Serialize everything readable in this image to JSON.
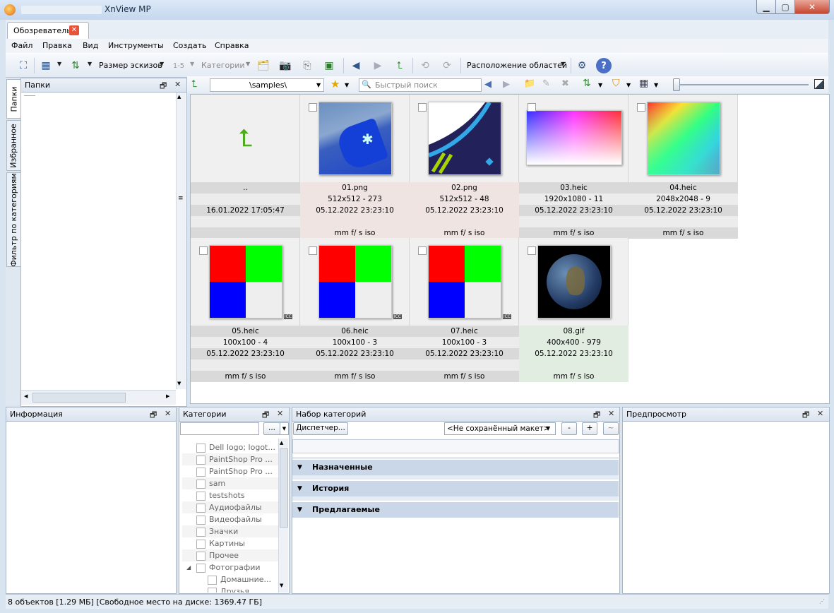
{
  "window": {
    "title": "XnView MP"
  },
  "tab": {
    "label": "Обозреватель"
  },
  "menu": [
    "Файл",
    "Правка",
    "Вид",
    "Инструменты",
    "Создать",
    "Справка"
  ],
  "toolbar": {
    "thumb_size_label": "Размер эскизов",
    "categories_label": "Категории",
    "layout_label": "Расположение областей"
  },
  "left_tabs": [
    "Папки",
    "Избранное",
    "Фильтр по категориям"
  ],
  "folders": {
    "title": "Папки"
  },
  "address": {
    "path": "\\samples\\",
    "search_placeholder": "Быстрый поиск"
  },
  "thumbnails": [
    {
      "name": "..",
      "info": "",
      "date": "16.01.2022 17:05:47",
      "exif": "",
      "kind": "up"
    },
    {
      "name": "01.png",
      "info": "512x512 - 273",
      "date": "05.12.2022 23:23:10",
      "exif": "mm f/ s iso",
      "kind": "hat",
      "bg": "#efe4e1"
    },
    {
      "name": "02.png",
      "info": "512x512 - 48",
      "date": "05.12.2022 23:23:10",
      "exif": "mm f/ s iso",
      "kind": "logo",
      "bg": "#efe4e1"
    },
    {
      "name": "03.heic",
      "info": "1920x1080 - 11",
      "date": "05.12.2022 23:23:10",
      "exif": "mm f/ s iso",
      "kind": "grad1"
    },
    {
      "name": "04.heic",
      "info": "2048x2048 - 9",
      "date": "05.12.2022 23:23:10",
      "exif": "mm f/ s iso",
      "kind": "grad2"
    },
    {
      "name": "05.heic",
      "info": "100x100 - 4",
      "date": "05.12.2022 23:23:10",
      "exif": "mm f/ s iso",
      "kind": "rgb"
    },
    {
      "name": "06.heic",
      "info": "100x100 - 3",
      "date": "05.12.2022 23:23:10",
      "exif": "mm f/ s iso",
      "kind": "rgb"
    },
    {
      "name": "07.heic",
      "info": "100x100 - 3",
      "date": "05.12.2022 23:23:10",
      "exif": "mm f/ s iso",
      "kind": "rgb"
    },
    {
      "name": "08.gif",
      "info": "400x400 - 979",
      "date": "05.12.2022 23:23:10",
      "exif": "mm f/ s iso",
      "kind": "earth",
      "bg": "#e2ede2"
    }
  ],
  "icc_label": "ICC",
  "info_panel": {
    "title": "Информация"
  },
  "categories_panel": {
    "title": "Категории",
    "more": "...",
    "items": [
      "Dell logo; logot...",
      "PaintShop Pro ...",
      "PaintShop Pro ...",
      "sam",
      "testshots",
      "Аудиофайлы",
      "Видеофайлы",
      "Значки",
      "Картины",
      "Прочее",
      "Фотографии"
    ],
    "sub_items": [
      "Домашние...",
      "Друзья"
    ]
  },
  "catset_panel": {
    "title": "Набор категорий",
    "manager_button": "Диспетчер...",
    "layout_select": "<Не сохранённый макет>",
    "btn_minus": "-",
    "btn_plus": "+",
    "btn_tilde": "~",
    "sections": [
      "Назначенные",
      "История",
      "Предлагаемые"
    ]
  },
  "preview_panel": {
    "title": "Предпросмотр"
  },
  "status": {
    "text": "8 объектов [1.29 МБ] [Свободное место на диске: 1369.47 ГБ]"
  }
}
